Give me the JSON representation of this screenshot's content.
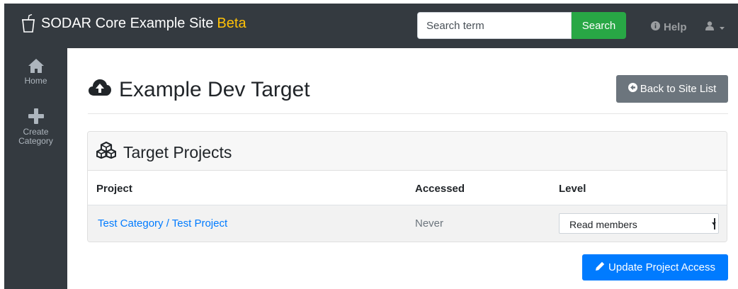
{
  "navbar": {
    "brand_icon": "cup-icon",
    "site_title": "SODAR Core Example Site",
    "beta_label": "Beta",
    "search": {
      "placeholder": "Search term",
      "value": ""
    },
    "search_button": "Search",
    "help_label": "Help",
    "help_icon": "info-circle-icon",
    "user_icon": "user-icon"
  },
  "sidebar": {
    "items": [
      {
        "label": "Home",
        "icon": "home-icon"
      },
      {
        "label": "Create Category",
        "label_line1": "Create",
        "label_line2": "Category",
        "icon": "plus-icon"
      }
    ]
  },
  "page": {
    "title": "Example Dev Target",
    "title_icon": "cloud-upload-icon",
    "back_button": "Back to Site List",
    "back_icon": "arrow-circle-left-icon"
  },
  "card": {
    "title": "Target Projects",
    "title_icon": "cubes-icon",
    "columns": [
      "Project",
      "Accessed",
      "Level"
    ],
    "rows": [
      {
        "project": "Test Category / Test Project",
        "accessed": "Never",
        "level": "Read members"
      }
    ]
  },
  "update_button": "Update Project Access",
  "update_icon": "pencil-icon",
  "colors": {
    "navbar": "#343a40",
    "beta": "#ffc107",
    "search_button": "#28a745",
    "back_button": "#6c757d",
    "primary": "#007bff"
  }
}
